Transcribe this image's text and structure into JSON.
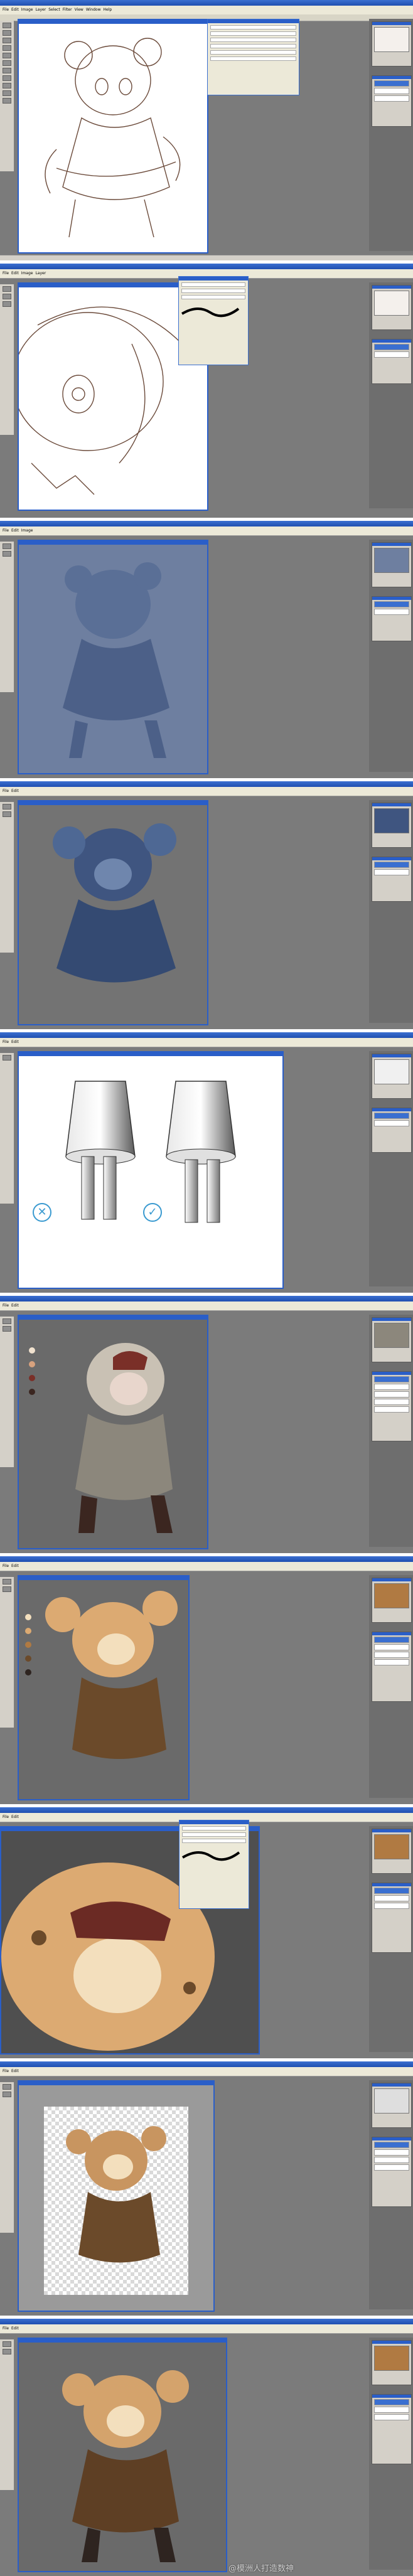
{
  "menu": [
    "File",
    "Edit",
    "Image",
    "Layer",
    "Select",
    "Filter",
    "View",
    "Window",
    "Help"
  ],
  "tutorial_marks": {
    "wrong": "✕",
    "right": "✓"
  },
  "swatches_step6": [
    "#f1e2cf",
    "#d8a27e",
    "#7a2f28",
    "#3b2620"
  ],
  "swatches_step7": [
    "#f3dfbd",
    "#dcaa72",
    "#b07a42",
    "#6b4a2a",
    "#2e2420"
  ],
  "colors": {
    "app_bg": "#7b7b7b",
    "title_blue": "#2a5ec8",
    "panel_gray": "#d4d0c8"
  },
  "watermark": "@模洲人打造数神"
}
